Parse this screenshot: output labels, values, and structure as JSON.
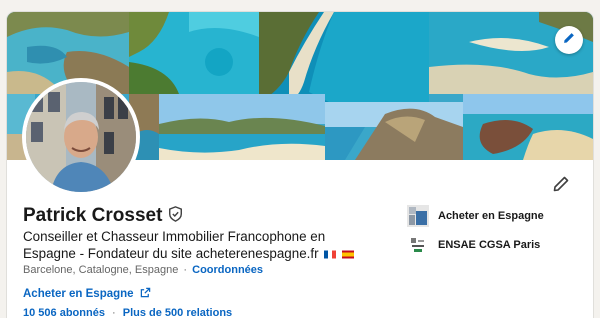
{
  "profile": {
    "name": "Patrick Crosset",
    "headline": "Conseiller et Chasseur Immobilier Francophone en Espagne - Fondateur du site acheterenespagne.fr",
    "location": "Barcelone, Catalogne, Espagne",
    "separator": "·",
    "contact_link": "Coordonnées",
    "website_label": "Acheter en Espagne",
    "followers": "10 506 abonnés",
    "connections": "Plus de 500 relations",
    "flags": [
      "france-flag",
      "spain-flag"
    ]
  },
  "side": {
    "company": "Acheter en Espagne",
    "school": "ENSAE CGSA Paris"
  },
  "icons": {
    "verified": "shield-check-icon",
    "edit": "pencil-icon",
    "external": "external-link-icon"
  },
  "colors": {
    "link": "#0a66c2",
    "text": "#191919",
    "muted": "#666666",
    "background": "#f4f2ee"
  }
}
